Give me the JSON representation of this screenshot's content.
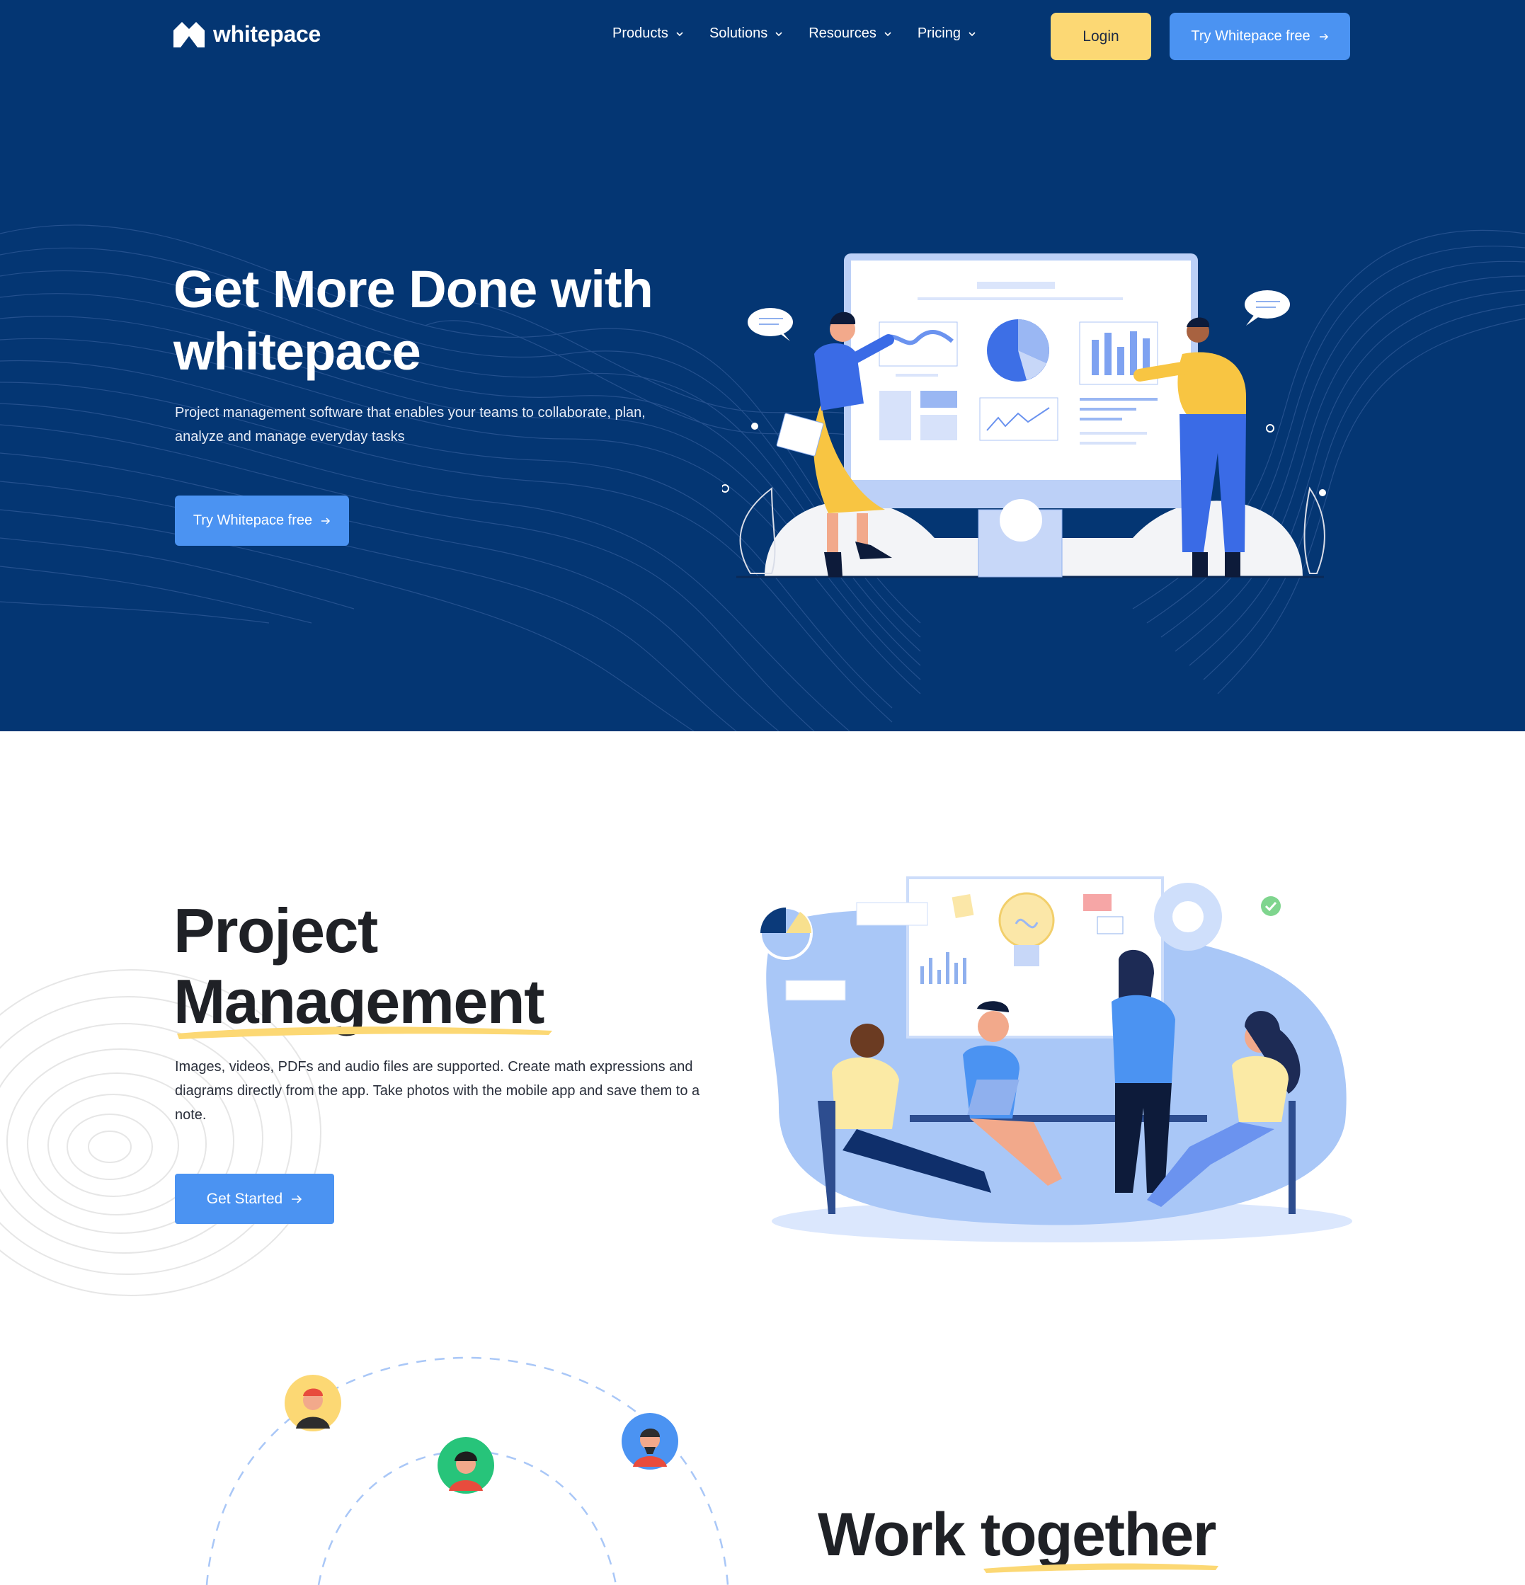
{
  "brand": {
    "name": "whitepace"
  },
  "nav": {
    "items": [
      {
        "label": "Products"
      },
      {
        "label": "Solutions"
      },
      {
        "label": "Resources"
      },
      {
        "label": "Pricing"
      }
    ],
    "login_label": "Login",
    "cta_label": "Try Whitepace free"
  },
  "hero": {
    "title": "Get More Done with whitepace",
    "subtitle": "Project management software that enables your teams to collaborate, plan, analyze and manage everyday tasks",
    "cta_label": "Try Whitepace free"
  },
  "project_management": {
    "title_line1": "Project",
    "title_line2": "Management",
    "description": "Images, videos, PDFs and audio files are supported. Create math expressions and diagrams directly from the app. Take photos with the mobile app and save them to a note.",
    "cta_label": "Get Started"
  },
  "work_together": {
    "title": "Work together"
  },
  "colors": {
    "hero_bg": "#043673",
    "accent_blue": "#4b93f2",
    "accent_yellow": "#fcd874",
    "text_dark": "#1f2126"
  }
}
